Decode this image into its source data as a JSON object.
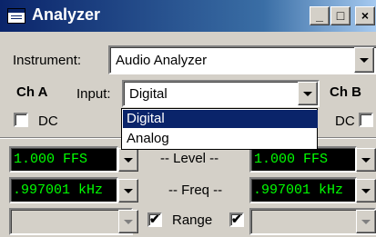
{
  "window": {
    "title": "Analyzer",
    "min_label": "_",
    "max_label": "□",
    "close_label": "×"
  },
  "instrument": {
    "label": "Instrument:",
    "value": "Audio Analyzer"
  },
  "channels": {
    "a_label": "Ch A",
    "b_label": "Ch B"
  },
  "input": {
    "label": "Input:",
    "value": "Digital",
    "options": [
      "Digital",
      "Analog"
    ]
  },
  "dc": {
    "a_label": "DC",
    "b_label": "DC"
  },
  "level": {
    "label": "-- Level --",
    "a_value": "1.000   FFS",
    "b_value": "1.000   FFS"
  },
  "freq": {
    "label": "-- Freq --",
    "a_value": ".997001 kHz",
    "b_value": ".997001 kHz"
  },
  "range": {
    "label": "Range",
    "a_checked": true,
    "b_checked": true
  },
  "colors": {
    "accent": "#0a246a",
    "lcd_bg": "#000000",
    "lcd_fg": "#00ff00"
  }
}
